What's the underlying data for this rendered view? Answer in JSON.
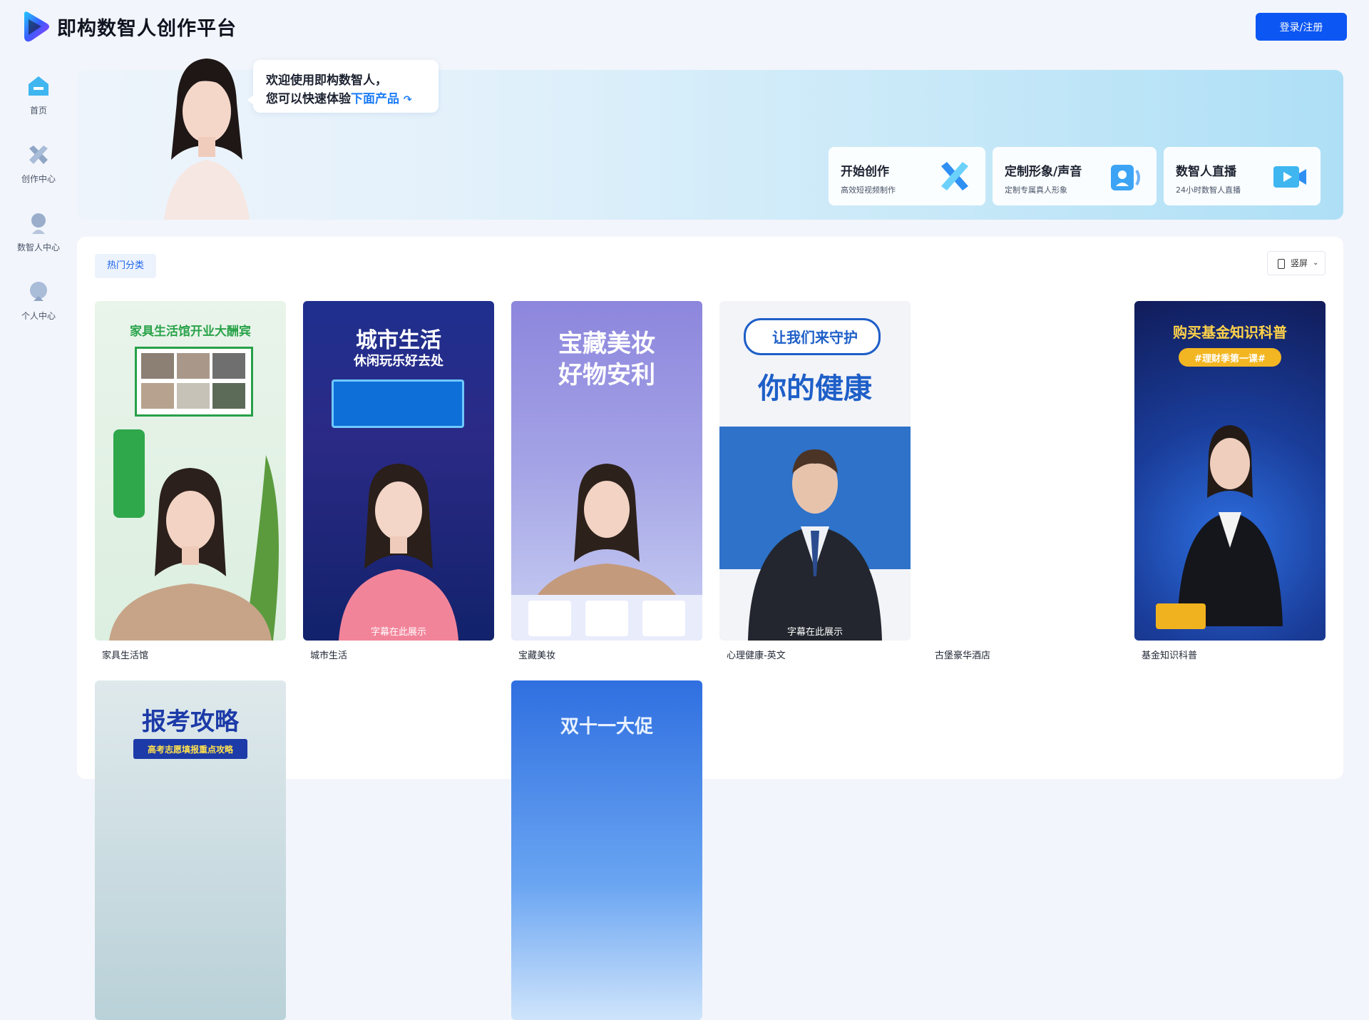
{
  "header": {
    "brand": "即构数智人创作平台",
    "login_label": "登录/注册"
  },
  "sidebar": {
    "items": [
      {
        "label": "首页",
        "icon": "home-icon"
      },
      {
        "label": "创作中心",
        "icon": "create-icon"
      },
      {
        "label": "数智人中心",
        "icon": "digital-human-icon"
      },
      {
        "label": "个人中心",
        "icon": "profile-icon"
      }
    ]
  },
  "banner": {
    "greeting_line1": "欢迎使用即构数智人，",
    "greeting_line2_prefix": "您可以快速体验",
    "greeting_line2_highlight": "下面产品",
    "cards": [
      {
        "title": "开始创作",
        "subtitle": "高效短视频制作"
      },
      {
        "title": "定制形象/声音",
        "subtitle": "定制专属真人形象"
      },
      {
        "title": "数智人直播",
        "subtitle": "24小时数智人直播"
      }
    ]
  },
  "content": {
    "category_label": "热门分类",
    "orientation_label": "竖屏",
    "templates": [
      {
        "name": "家具生活馆",
        "headline": "家具生活馆开业大酬宾"
      },
      {
        "name": "城市生活",
        "headline": "城市生活",
        "headline2": "休闲玩乐好去处",
        "subtitle": "字幕在此展示"
      },
      {
        "name": "宝藏美妆",
        "headline": "宝藏美妆",
        "headline2": "好物安利"
      },
      {
        "name": "心理健康-英文",
        "headline": "让我们来守护",
        "headline2": "你的健康",
        "subtitle": "字幕在此展示"
      },
      {
        "name": "古堡豪华酒店"
      },
      {
        "name": "基金知识科普",
        "headline": "购买基金知识科普",
        "headline2": "#理财季第一课#"
      },
      {
        "name": "",
        "headline": "报考攻略",
        "headline2": "高考志愿填报重点攻略"
      },
      {
        "name": "",
        "headline": "双十一大促"
      }
    ]
  },
  "colors": {
    "primary": "#0c56f3",
    "accent": "#1b7cf5",
    "page_bg": "#f2f5fb"
  }
}
